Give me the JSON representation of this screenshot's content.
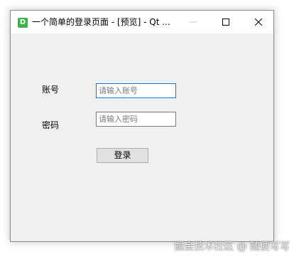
{
  "window": {
    "title": "一个简单的登录页面 - [预览] - Qt ...",
    "icon_letter": "D",
    "icon_color": "#3bb54a",
    "controls": [
      "minimize-icon",
      "maximize-icon",
      "close-icon"
    ]
  },
  "form": {
    "account_label": "账号",
    "account_placeholder": "请输入账号",
    "password_label": "密码",
    "password_placeholder": "请输入密码",
    "login_label": "登录",
    "focus_color": "#0078d7"
  },
  "watermark": "掘金技术社区 @ 随便写写"
}
